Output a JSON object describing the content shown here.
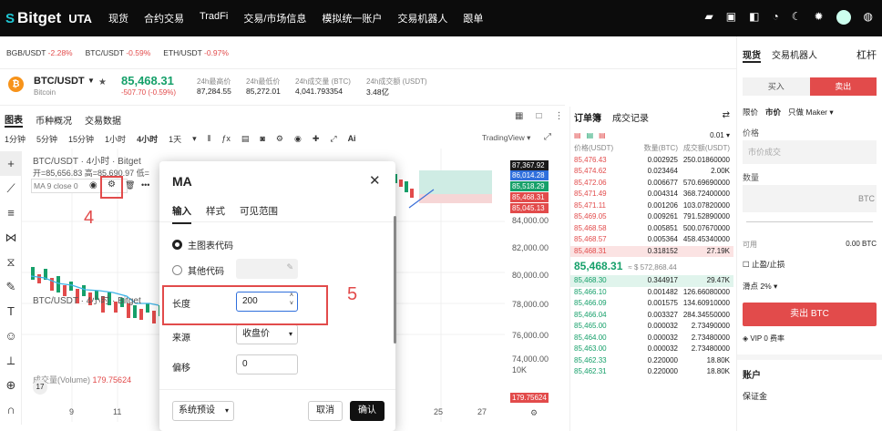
{
  "topbar": {
    "logo": "Bitget",
    "uta": "UTA",
    "nav": [
      "现货",
      "合约交易",
      "TradFi",
      "交易/市场信息",
      "模拟统一账户",
      "交易机器人",
      "跟单"
    ]
  },
  "ticker": [
    {
      "pair": "BGB/USDT",
      "change": "-2.28%"
    },
    {
      "pair": "BTC/USDT",
      "change": "-0.59%"
    },
    {
      "pair": "ETH/USDT",
      "change": "-0.97%"
    }
  ],
  "pair": {
    "name": "BTC/USDT",
    "sub": "Bitcoin",
    "price": "85,468.31",
    "change": "-507.70 (-0.59%)",
    "stats": [
      {
        "label": "24h最高价",
        "value": "87,284.55"
      },
      {
        "label": "24h最低价",
        "value": "85,272.01"
      },
      {
        "label": "24h成交量 (BTC)",
        "value": "4,041.793354"
      },
      {
        "label": "24h成交额 (USDT)",
        "value": "3.48亿"
      }
    ]
  },
  "chart_tabs": [
    "图表",
    "币种概况",
    "交易数据"
  ],
  "timeframes": [
    "1分钟",
    "5分钟",
    "15分钟",
    "1小时",
    "4小时",
    "1天"
  ],
  "tradingview": "TradingView",
  "chart_info": {
    "title": "BTC/USDT · 4小时 · Bitget",
    "ohlc": "开=85,656.83 高=85,690.97 低=",
    "ma_label": "MA 9 close 0",
    "lower_title": "BTC/USDT · 4小时 · Bitget",
    "volume_label": "成交量(Volume)",
    "volume_value": "179.75624",
    "x_labels": [
      "9",
      "11",
      "25",
      "27"
    ]
  },
  "yaxis": {
    "tags": [
      "87,367.92",
      "86,014.28",
      "85,518.29",
      "85,468.31",
      "85,045.13"
    ],
    "labels": [
      "84,000.00",
      "82,000.00",
      "80,000.00",
      "78,000.00",
      "76,000.00",
      "74,000.00",
      "10K"
    ],
    "vol_tag": "179.75624"
  },
  "orderbook": {
    "tabs": [
      "订单簿",
      "成交记录"
    ],
    "precision": "0.01",
    "headers": [
      "价格(USDT)",
      "数量(BTC)",
      "成交额(USDT)"
    ],
    "asks": [
      [
        "85,476.43",
        "0.002925",
        "250.01860000"
      ],
      [
        "85,474.62",
        "0.023464",
        "2.00K"
      ],
      [
        "85,472.06",
        "0.006677",
        "570.69690000"
      ],
      [
        "85,471.49",
        "0.004314",
        "368.72400000"
      ],
      [
        "85,471.11",
        "0.001206",
        "103.07820000"
      ],
      [
        "85,469.05",
        "0.009261",
        "791.52890000"
      ],
      [
        "85,468.58",
        "0.005851",
        "500.07670000"
      ],
      [
        "85,468.57",
        "0.005364",
        "458.45340000"
      ],
      [
        "85,468.31",
        "0.318152",
        "27.19K"
      ]
    ],
    "mid_price": "85,468.31",
    "mid_sub": "≈ $ 572,868.44",
    "bids": [
      [
        "85,468.30",
        "0.344917",
        "29.47K"
      ],
      [
        "85,466.10",
        "0.001482",
        "126.66080000"
      ],
      [
        "85,466.09",
        "0.001575",
        "134.60910000"
      ],
      [
        "85,466.04",
        "0.003327",
        "284.34550000"
      ],
      [
        "85,465.00",
        "0.000032",
        "2.73490000"
      ],
      [
        "85,464.00",
        "0.000032",
        "2.73480000"
      ],
      [
        "85,463.00",
        "0.000032",
        "2.73480000"
      ],
      [
        "85,462.33",
        "0.220000",
        "18.80K"
      ],
      [
        "85,462.31",
        "0.220000",
        "18.80K"
      ]
    ]
  },
  "right_panel": {
    "tabs": [
      "现货",
      "交易机器人"
    ],
    "leverage": "杠杆",
    "buy": "买入",
    "sell": "卖出",
    "order_types": [
      "限价",
      "市价",
      "只做 Maker"
    ],
    "price_label": "价格",
    "price_placeholder": "市价成交",
    "qty_label": "数量",
    "qty_unit": "BTC",
    "available_label": "可用",
    "available_value": "0.00 BTC",
    "tpsl": "止盈/止损",
    "slippage": "滑点 2%",
    "sell_btn": "卖出 BTC",
    "vip": "VIP 0 费率",
    "account": "账户",
    "margin": "保证金"
  },
  "modal": {
    "title": "MA",
    "tabs": [
      "输入",
      "样式",
      "可见范围"
    ],
    "radio1": "主图表代码",
    "radio2": "其他代码",
    "length_label": "长度",
    "length_value": "200",
    "source_label": "来源",
    "source_value": "收盘价",
    "offset_label": "偏移",
    "offset_value": "0",
    "preset": "系统预设",
    "cancel": "取消",
    "confirm": "确认"
  },
  "annotations": {
    "a4": "4",
    "a5": "5"
  },
  "colors": {
    "up": "#16a06a",
    "down": "#e24b4b",
    "accent": "#e24b4b",
    "dark": "#0c0c0c"
  }
}
